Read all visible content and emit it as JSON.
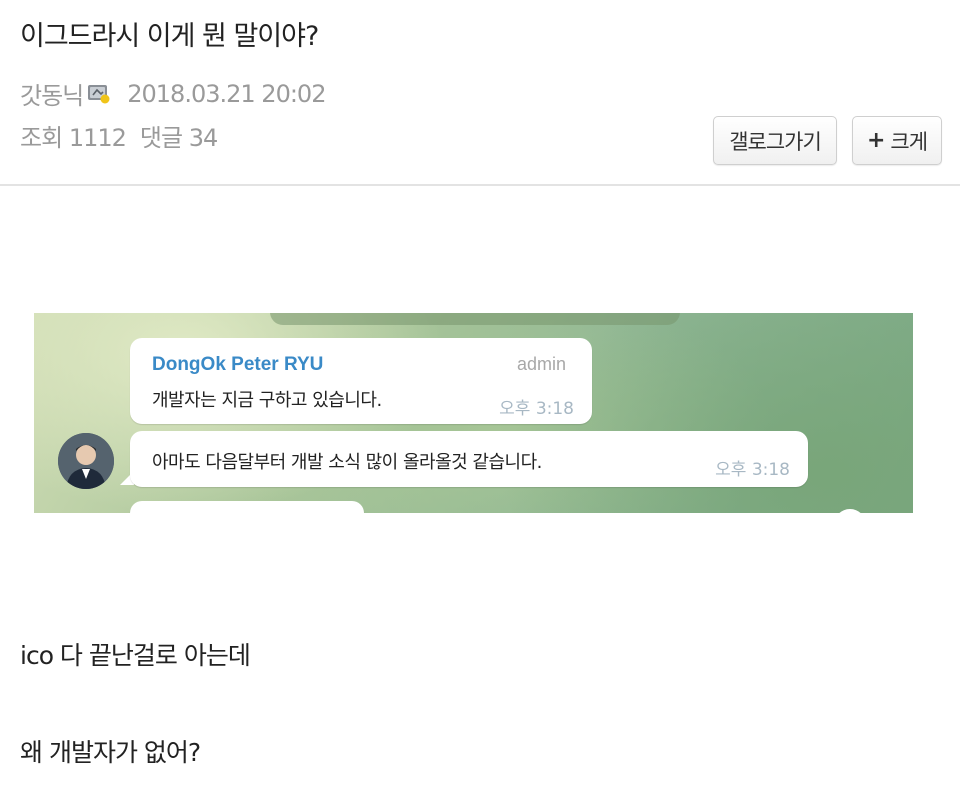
{
  "post": {
    "title": "이그드라시 이게 뭔 말이야?",
    "author": "갓동닉",
    "author_level_icon": "level-badge-icon",
    "datetime": "2018.03.21 20:02",
    "views_label": "조회",
    "views": "1112",
    "comments_label": "댓글",
    "comments": "34"
  },
  "buttons": {
    "gallery": "갤로그가기",
    "enlarge_icon": "+",
    "enlarge": "크게"
  },
  "chat_image": {
    "message1": {
      "sender": "DongOk Peter RYU",
      "role": "admin",
      "text": "개발자는 지금 구하고 있습니다.",
      "time": "오후 3:18"
    },
    "message2": {
      "text": "아마도 다음달부터 개발 소식 많이 올라올것 같습니다.",
      "time": "오후 3:18"
    }
  },
  "content": {
    "line1": "ico 다 끝난걸로 아는데",
    "line2": "왜 개발자가 없어?"
  },
  "colors": {
    "sender": "#3a8ac7",
    "meta": "#9a9a9a",
    "divider": "#e3e3e3"
  }
}
